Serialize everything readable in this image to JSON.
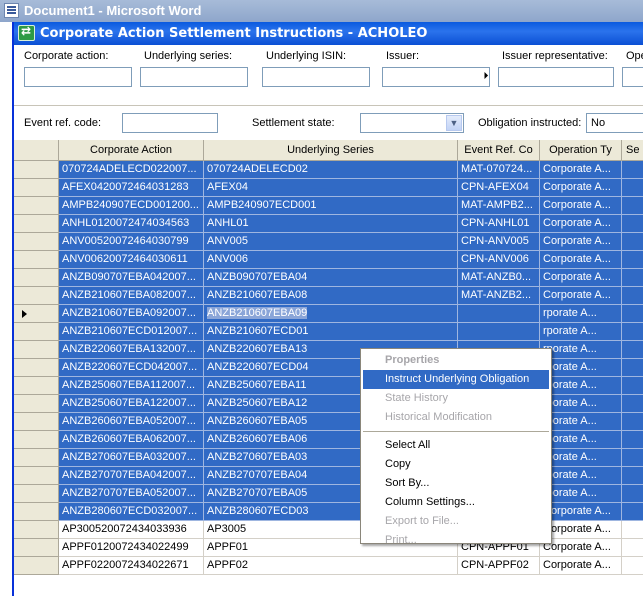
{
  "outer_window": {
    "title": "Document1 - Microsoft Word"
  },
  "window": {
    "title": "Corporate Action Settlement Instructions - ACHOLEO"
  },
  "filters": {
    "corporate_action_label": "Corporate action:",
    "underlying_series_label": "Underlying series:",
    "underlying_isin_label": "Underlying ISIN:",
    "issuer_label": "Issuer:",
    "issuer_rep_label": "Issuer representative:",
    "ope_label": "Ope",
    "event_ref_label": "Event ref. code:",
    "settlement_state_label": "Settlement state:",
    "settlement_state_value": "",
    "obligation_instructed_label": "Obligation instructed:",
    "obligation_instructed_value": "No"
  },
  "grid": {
    "columns": [
      "Corporate Action",
      "Underlying Series",
      "Event Ref. Co",
      "Operation Ty",
      "Se"
    ],
    "rows": [
      {
        "ca": "070724ADELECD022007...",
        "us": "070724ADELECD02",
        "ev": "MAT-070724...",
        "op": "Corporate A...",
        "selected": true
      },
      {
        "ca": "AFEX0420072464031283",
        "us": "AFEX04",
        "ev": "CPN-AFEX04",
        "op": "Corporate A...",
        "selected": true
      },
      {
        "ca": "AMPB240907ECD001200...",
        "us": "AMPB240907ECD001",
        "ev": "MAT-AMPB2...",
        "op": "Corporate A...",
        "selected": true
      },
      {
        "ca": "ANHL0120072474034563",
        "us": "ANHL01",
        "ev": "CPN-ANHL01",
        "op": "Corporate A...",
        "selected": true
      },
      {
        "ca": "ANV00520072464030799",
        "us": "ANV005",
        "ev": "CPN-ANV005",
        "op": "Corporate A...",
        "selected": true
      },
      {
        "ca": "ANV00620072464030611",
        "us": "ANV006",
        "ev": "CPN-ANV006",
        "op": "Corporate A...",
        "selected": true
      },
      {
        "ca": "ANZB090707EBA042007...",
        "us": "ANZB090707EBA04",
        "ev": "MAT-ANZB0...",
        "op": "Corporate A...",
        "selected": true
      },
      {
        "ca": "ANZB210607EBA082007...",
        "us": "ANZB210607EBA08",
        "ev": "MAT-ANZB2...",
        "op": "Corporate A...",
        "selected": true
      },
      {
        "ca": "ANZB210607EBA092007...",
        "us": "ANZB210607EBA09",
        "ev": "",
        "op": "rporate A...",
        "selected": true,
        "current": true
      },
      {
        "ca": "ANZB210607ECD012007...",
        "us": "ANZB210607ECD01",
        "ev": "",
        "op": "rporate A...",
        "selected": true
      },
      {
        "ca": "ANZB220607EBA132007...",
        "us": "ANZB220607EBA13",
        "ev": "",
        "op": "rporate A...",
        "selected": true
      },
      {
        "ca": "ANZB220607ECD042007...",
        "us": "ANZB220607ECD04",
        "ev": "",
        "op": "rporate A...",
        "selected": true
      },
      {
        "ca": "ANZB250607EBA112007...",
        "us": "ANZB250607EBA11",
        "ev": "",
        "op": "rporate A...",
        "selected": true
      },
      {
        "ca": "ANZB250607EBA122007...",
        "us": "ANZB250607EBA12",
        "ev": "",
        "op": "rporate A...",
        "selected": true
      },
      {
        "ca": "ANZB260607EBA052007...",
        "us": "ANZB260607EBA05",
        "ev": "",
        "op": "rporate A...",
        "selected": true
      },
      {
        "ca": "ANZB260607EBA062007...",
        "us": "ANZB260607EBA06",
        "ev": "",
        "op": "rporate A...",
        "selected": true
      },
      {
        "ca": "ANZB270607EBA032007...",
        "us": "ANZB270607EBA03",
        "ev": "",
        "op": "rporate A...",
        "selected": true
      },
      {
        "ca": "ANZB270707EBA042007...",
        "us": "ANZB270707EBA04",
        "ev": "",
        "op": "rporate A...",
        "selected": true
      },
      {
        "ca": "ANZB270707EBA052007...",
        "us": "ANZB270707EBA05",
        "ev": "",
        "op": "rporate A...",
        "selected": true
      },
      {
        "ca": "ANZB280607ECD032007...",
        "us": "ANZB280607ECD03",
        "ev": "MAT-ANZB2...",
        "op": "Corporate A...",
        "selected": true
      },
      {
        "ca": "AP300520072434033936",
        "us": "AP3005",
        "ev": "CPN-AP3005",
        "op": "Corporate A...",
        "selected": false
      },
      {
        "ca": "APPF0120072434022499",
        "us": "APPF01",
        "ev": "CPN-APPF01",
        "op": "Corporate A...",
        "selected": false
      },
      {
        "ca": "APPF0220072434022671",
        "us": "APPF02",
        "ev": "CPN-APPF02",
        "op": "Corporate A...",
        "selected": false
      }
    ]
  },
  "context_menu": {
    "items": [
      {
        "label": "Properties",
        "state": "disabled-bold"
      },
      {
        "label": "Instruct Underlying Obligation",
        "state": "highlighted"
      },
      {
        "label": "State History",
        "state": "disabled"
      },
      {
        "label": "Historical Modification",
        "state": "disabled"
      },
      {
        "label": "",
        "state": "separator"
      },
      {
        "label": "Select All",
        "state": "enabled"
      },
      {
        "label": "Copy",
        "state": "enabled"
      },
      {
        "label": "Sort By...",
        "state": "enabled"
      },
      {
        "label": "Column Settings...",
        "state": "enabled"
      },
      {
        "label": "Export to File...",
        "state": "disabled"
      },
      {
        "label": "Print...",
        "state": "disabled"
      }
    ]
  },
  "icons": {
    "row_indicator": "triangle-right-icon",
    "dropdown": "chevron-down-icon"
  },
  "colors": {
    "selection": "#316ac5",
    "title_bar": "#0a5adf"
  }
}
